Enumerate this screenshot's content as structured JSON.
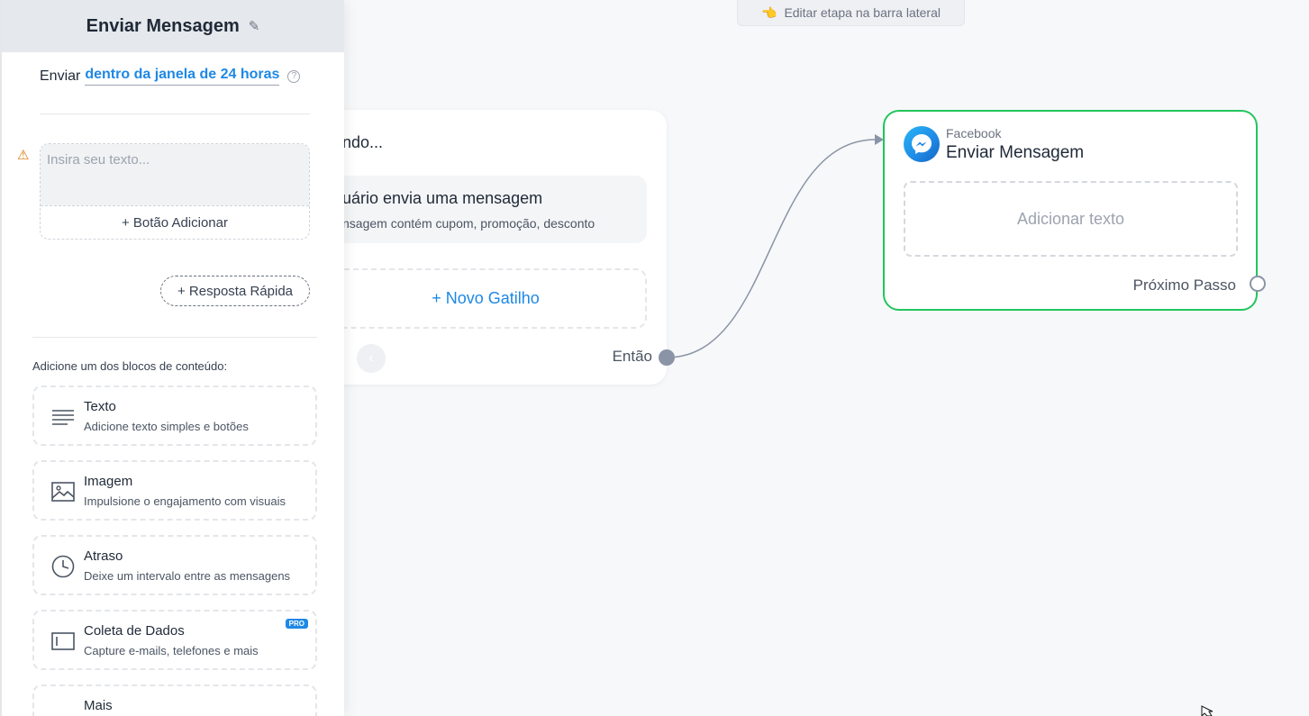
{
  "hint": {
    "icon": "pointing-hand-icon",
    "text": "Editar etapa na barra lateral"
  },
  "trigger_node": {
    "title": "ndo...",
    "item_title": "uário envia uma mensagem",
    "item_desc": "nsagem contém cupom, promoção, desconto",
    "new_trigger": "+ Novo Gatilho",
    "then_label": "Então"
  },
  "action_node": {
    "platform": "Facebook",
    "title": "Enviar Mensagem",
    "add_text": "Adicionar texto",
    "next_label": "Próximo Passo",
    "border_color": "#22c55e"
  },
  "sidebar": {
    "title": "Enviar Mensagem",
    "send_label": "Enviar",
    "send_window_link": "dentro da janela de 24 horas",
    "text_placeholder": "Insira seu texto...",
    "add_button": "+ Botão Adicionar",
    "quick_reply": "+ Resposta Rápida",
    "blocks_label": "Adicione um dos blocos de conteúdo:",
    "blocks": [
      {
        "title": "Texto",
        "desc": "Adicione texto simples e botões",
        "icon": "text-lines-icon"
      },
      {
        "title": "Imagem",
        "desc": "Impulsione o engajamento com visuais",
        "icon": "image-icon"
      },
      {
        "title": "Atraso",
        "desc": "Deixe um intervalo entre as mensagens",
        "icon": "clock-icon"
      },
      {
        "title": "Coleta de Dados",
        "desc": "Capture e-mails, telefones e mais",
        "icon": "form-field-icon",
        "badge": "PRO"
      },
      {
        "title": "Mais",
        "desc": "",
        "icon": "more-dots-icon"
      }
    ]
  },
  "colors": {
    "accent": "#1e88e5",
    "success": "#22c55e"
  }
}
